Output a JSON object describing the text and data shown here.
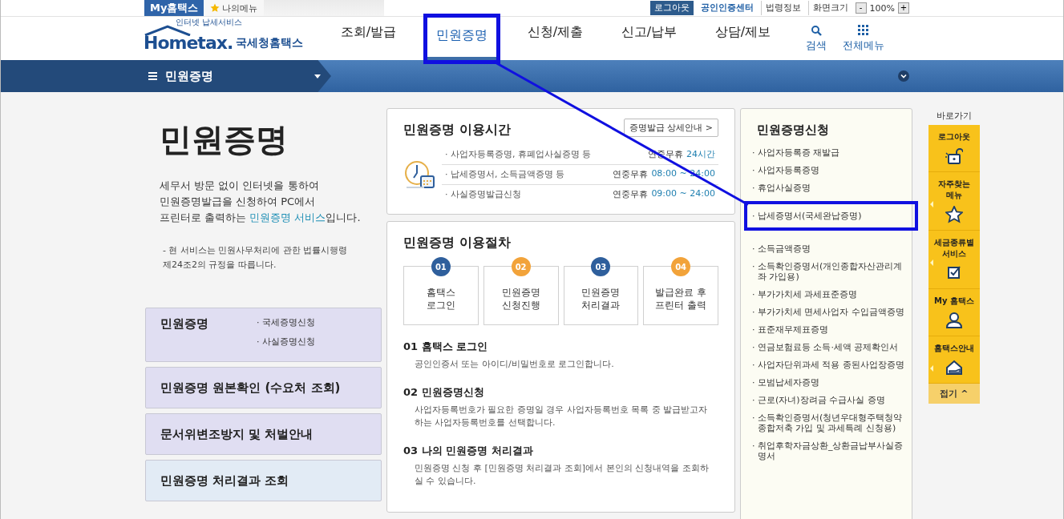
{
  "top_bar": {
    "my_hometax": "My홈택스",
    "my_menu": "나의메뉴",
    "links": [
      {
        "label": "로그아웃",
        "kind": "dark"
      },
      {
        "label": "공인인증센터",
        "kind": "blue"
      },
      {
        "label": "법령정보",
        "kind": "plain"
      },
      {
        "label": "화면크기",
        "kind": "plain"
      }
    ],
    "zoom": {
      "minus": "-",
      "value": "100%",
      "plus": "+"
    }
  },
  "header": {
    "logo_tagline": "인터넷 납세서비스",
    "logo": "Hometax.",
    "logo_name": "국세청홈택스",
    "nav": [
      {
        "label": "조회/발급",
        "selected": false,
        "highlighted": false
      },
      {
        "label": "민원증명",
        "selected": true,
        "highlighted": true
      },
      {
        "label": "신청/제출",
        "selected": false,
        "highlighted": false
      },
      {
        "label": "신고/납부",
        "selected": false,
        "highlighted": false
      },
      {
        "label": "상담/제보",
        "selected": false,
        "highlighted": false
      }
    ],
    "tools": [
      {
        "label": "검색",
        "kind": "search"
      },
      {
        "label": "전체메뉴",
        "kind": "grid"
      }
    ]
  },
  "subnav": {
    "title": "민원증명"
  },
  "intro": {
    "title": "민원증명",
    "description": "세무서 방문 없이 인터넷을 통하여\n민원증명발급을 신청하여 PC에서\n프린터로 출력하는 ",
    "description_link": "민원증명 서비스",
    "description_end": "입니다.",
    "note": "- 현 서비스는 민원사무처리에 관한 법률시행령\n제24조2의 규정을 따릅니다."
  },
  "menu_cards": [
    {
      "title": "민원증명",
      "kind": "purple",
      "links": [
        "· 국세증명신청",
        "· 사실증명신청"
      ]
    },
    {
      "title": "민원증명 원본확인 (수요처 조회)",
      "kind": "purple"
    },
    {
      "title": "문서위변조방지 및 처벌안내",
      "kind": "purple"
    },
    {
      "title": "민원증명 처리결과 조회",
      "kind": "blue"
    }
  ],
  "hours": {
    "title": "민원증명 이용시간",
    "button": "증명발급 상세안내 >",
    "rows": [
      {
        "item": "· 사업자등록증명, 휴폐업사실증명 등",
        "days": "연중무휴",
        "time": "24시간"
      },
      {
        "item": "· 납세증명서, 소득금액증명 등",
        "days": "연중무휴",
        "time": "08:00 ~ 24:00"
      },
      {
        "item": "· 사실증명발급신청",
        "days": "연중무휴",
        "time": "09:00 ~ 24:00"
      }
    ]
  },
  "procedure": {
    "title": "민원증명 이용절차",
    "steps": [
      {
        "num": "01",
        "label": "홈택스\n로그인",
        "color": "#2f5f9c"
      },
      {
        "num": "02",
        "label": "민원증명\n신청진행",
        "color": "#f2a33a"
      },
      {
        "num": "03",
        "label": "민원증명\n처리결과",
        "color": "#2f5f9c"
      },
      {
        "num": "04",
        "label": "발급완료 후\n프린터 출력",
        "color": "#f2a33a"
      }
    ],
    "sections": [
      {
        "heading": "01 홈택스 로그인",
        "text": "공인인증서 또는 아이디/비밀번호로 로그인합니다."
      },
      {
        "heading": "02 민원증명신청",
        "text": "사업자등록번호가 필요한 증명일 경우 사업자등록번호 목록 중 발급받고자 하는 사업자등록번호를 선택합니다."
      },
      {
        "heading": "03 나의 민원증명 처리결과",
        "text": "민원증명 신청 후 [민원증명 처리결과 조회]에서 본인의 신청내역을 조회하실 수 있습니다."
      }
    ]
  },
  "apply": {
    "title": "민원증명신청",
    "items": [
      {
        "label": "· 사업자등록증 재발급",
        "highlighted": false
      },
      {
        "label": "· 사업자등록증명",
        "highlighted": false
      },
      {
        "label": "· 휴업사실증명",
        "highlighted": false
      },
      {
        "label": "· 납세증명서(국세완납증명)",
        "highlighted": true
      },
      {
        "label": "· 소득금액증명",
        "highlighted": false
      },
      {
        "label": "· 소득확인증명서(개인종합자산관리계좌 가입용)",
        "highlighted": false
      },
      {
        "label": "· 부가가치세 과세표준증명",
        "highlighted": false
      },
      {
        "label": "· 부가가치세 면세사업자 수입금액증명",
        "highlighted": false
      },
      {
        "label": "· 표준재무제표증명",
        "highlighted": false
      },
      {
        "label": "· 연금보험료등 소득·세액 공제확인서",
        "highlighted": false
      },
      {
        "label": "· 사업자단위과세 적용 종된사업장증명",
        "highlighted": false
      },
      {
        "label": "· 모범납세자증명",
        "highlighted": false
      },
      {
        "label": "· 근로(자녀)장려금 수급사실 증명",
        "highlighted": false
      },
      {
        "label": "· 소득확인증명서(청년우대형주택청약종합저축 가입 및 과세특례 신청용)",
        "highlighted": false
      },
      {
        "label": "· 취업후학자금상환_상환금납부사실증명서",
        "highlighted": false
      }
    ]
  },
  "quick_menu": {
    "title": "바로가기",
    "items": [
      {
        "label": "로그아웃",
        "kind": "unlock",
        "submenu": false
      },
      {
        "label": "자주찾는\n메뉴",
        "kind": "star",
        "submenu": true
      },
      {
        "label": "세금종류별\n서비스",
        "kind": "check",
        "submenu": true
      },
      {
        "label": "My 홈택스",
        "kind": "person",
        "submenu": false
      },
      {
        "label": "홈택스안내",
        "kind": "house",
        "submenu": true
      }
    ],
    "collapse": "접기 ^"
  }
}
